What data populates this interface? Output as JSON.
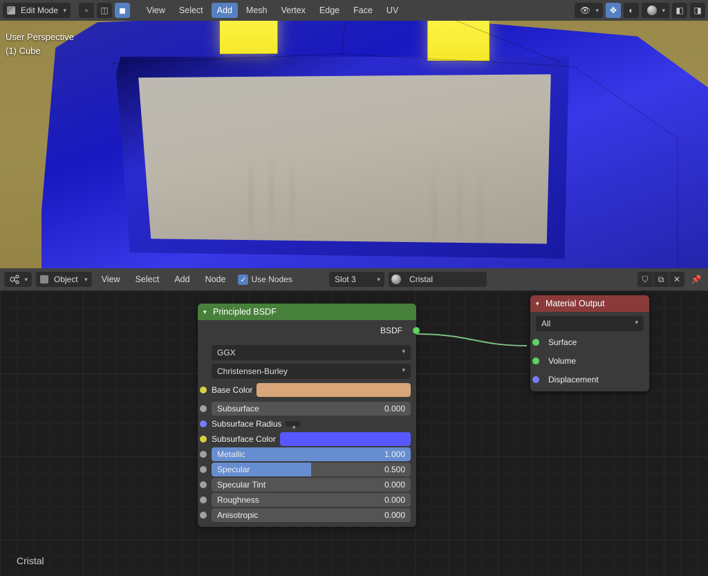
{
  "viewport": {
    "mode": "Edit Mode",
    "menus": [
      "View",
      "Select",
      "Add",
      "Mesh",
      "Vertex",
      "Edge",
      "Face",
      "UV"
    ],
    "highlighted_menu": "Add",
    "overlay": {
      "line1": "User Perspective",
      "line2": "(1) Cube"
    }
  },
  "node_editor": {
    "header": {
      "editor_type_icon": "node-tree-icon",
      "object_menu": "Object",
      "menus": [
        "View",
        "Select",
        "Add",
        "Node"
      ],
      "use_nodes_label": "Use Nodes",
      "use_nodes_checked": true,
      "slot": "Slot 3",
      "material_name": "Cristal"
    },
    "canvas_label": "Cristal",
    "principled": {
      "title": "Principled BSDF",
      "output_label": "BSDF",
      "distribution": "GGX",
      "subsurface_method": "Christensen-Burley",
      "base_color_label": "Base Color",
      "base_color": "#d9a679",
      "rows": [
        {
          "label": "Subsurface",
          "value": "0.000",
          "fill": 0,
          "socket": "s-float"
        },
        {
          "label": "Subsurface Radius",
          "type": "dropdown",
          "socket": "s-vec"
        },
        {
          "label": "Subsurface Color",
          "type": "color",
          "color": "#5858ff",
          "socket": "s-color"
        },
        {
          "label": "Metallic",
          "value": "1.000",
          "fill": 100,
          "socket": "s-float"
        },
        {
          "label": "Specular",
          "value": "0.500",
          "fill": 50,
          "socket": "s-float"
        },
        {
          "label": "Specular Tint",
          "value": "0.000",
          "fill": 0,
          "socket": "s-float"
        },
        {
          "label": "Roughness",
          "value": "0.000",
          "fill": 0,
          "socket": "s-float"
        },
        {
          "label": "Anisotropic",
          "value": "0.000",
          "fill": 0,
          "socket": "s-float"
        }
      ]
    },
    "output_node": {
      "title": "Material Output",
      "target": "All",
      "inputs": [
        "Surface",
        "Volume",
        "Displacement"
      ]
    }
  }
}
